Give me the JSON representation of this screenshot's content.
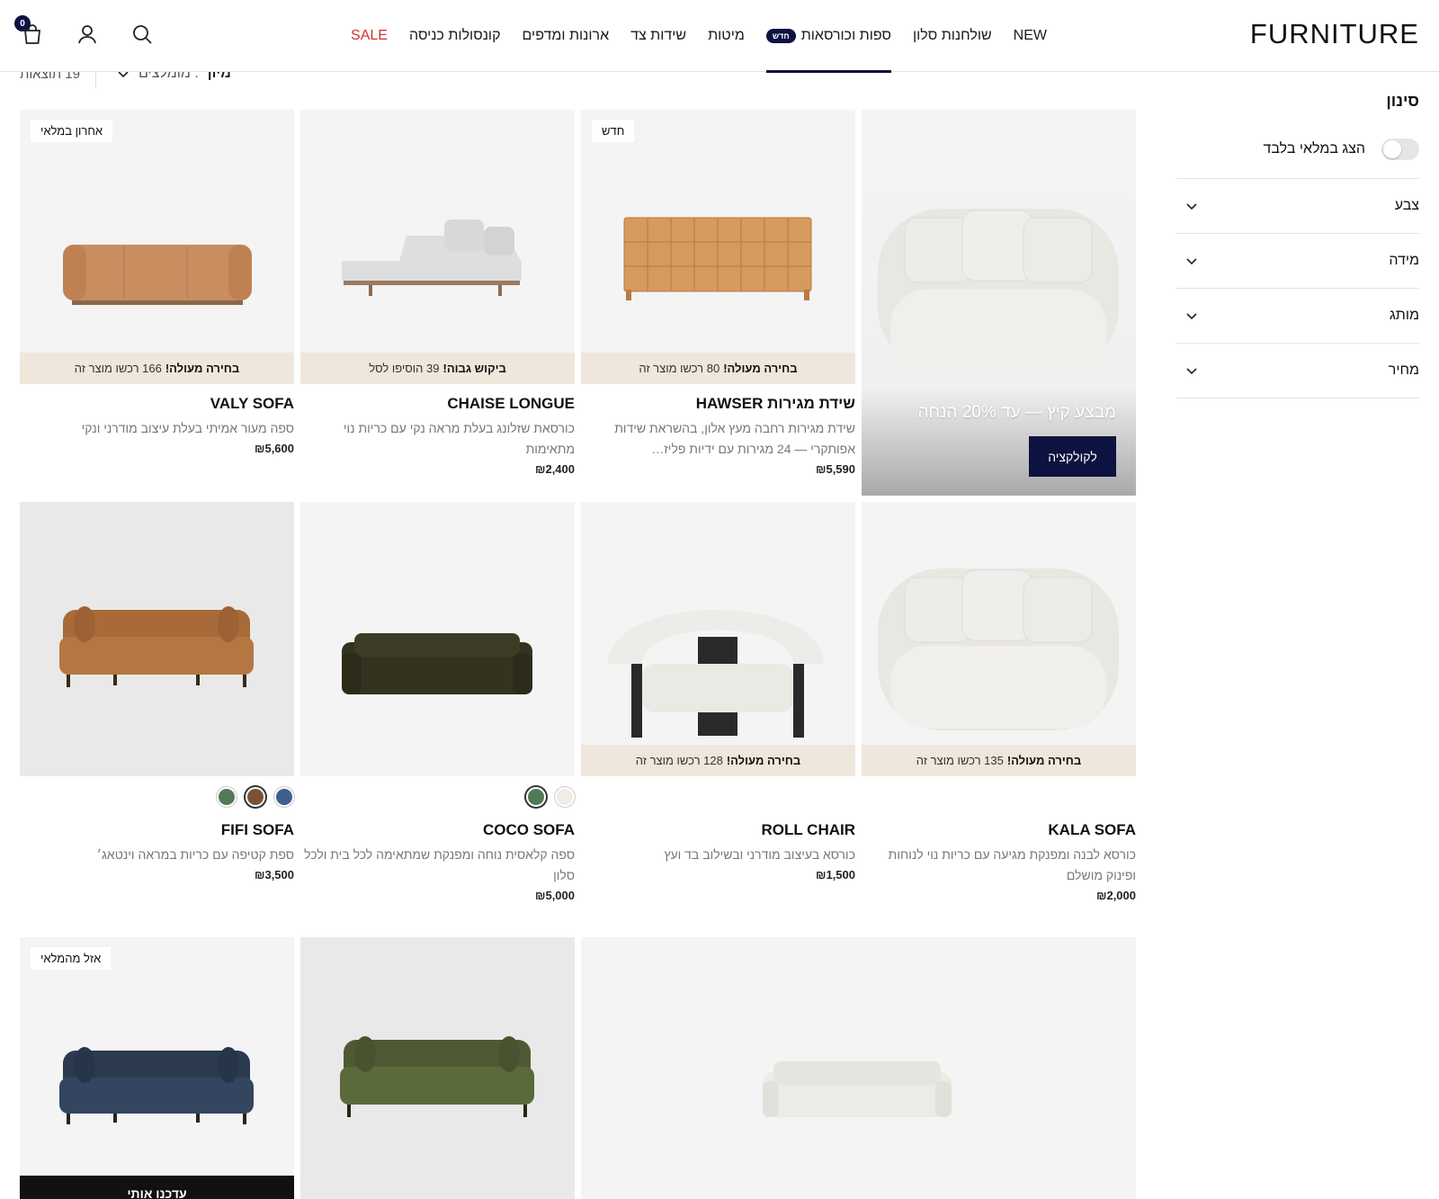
{
  "header": {
    "logo": "FURNITURE",
    "nav": [
      {
        "label": "NEW"
      },
      {
        "label": "שולחנות סלון"
      },
      {
        "label": "ספות וכורסאות",
        "badge": "חדש",
        "active": true
      },
      {
        "label": "מיטות"
      },
      {
        "label": "שידות צד"
      },
      {
        "label": "ארונות ומדפים"
      },
      {
        "label": "קונסולות כניסה"
      },
      {
        "label": "SALE"
      }
    ],
    "cart_count": "0"
  },
  "toolbar": {
    "results": "19 תוצאות",
    "sort_label": "מיון",
    "sort_value": ": מומלצים"
  },
  "filters": {
    "title": "סינון",
    "in_stock_label": "הצג במלאי בלבד",
    "in_stock_on": false,
    "facets": [
      "צבע",
      "מידה",
      "מותג",
      "מחיר"
    ]
  },
  "promo": {
    "text": "מבצע קיץ — עד 20% הנחה",
    "button": "לקולקציה"
  },
  "products": [
    {
      "name": "שידת מגירות HAWSER",
      "desc": "שידת מגירות רחבה מעץ אלון, בהשראת שידות אפותקרי — 24 מגירות עם ידיות פליז…",
      "price": "₪5,590",
      "tag": "חדש",
      "strip_bold": "בחירה מעולה!",
      "strip_text": "80 רכשו מוצר זה"
    },
    {
      "name": "CHAISE LONGUE",
      "desc": "כורסאת שזלונג בעלת מראה נקי עם כריות נוי מתאימות",
      "price": "₪2,400",
      "strip_bold": "ביקוש גבוה!",
      "strip_text": "39 הוסיפו לסל"
    },
    {
      "name": "VALY SOFA",
      "desc": "ספה מעור אמיתי בעלת עיצוב מודרני ונקי",
      "price": "₪5,600",
      "tag": "אחרון במלאי",
      "strip_bold": "בחירה מעולה!",
      "strip_text": "166 רכשו מוצר זה"
    },
    {
      "name": "KALA SOFA",
      "desc": "כורסא לבנה ומפנקת מגיעה עם כריות נוי לנוחות ופינוק מושלם",
      "price": "₪2,000",
      "strip_bold": "בחירה מעולה!",
      "strip_text": "135 רכשו מוצר זה"
    },
    {
      "name": "ROLL CHAIR",
      "desc": "כורסא בעיצוב מודרני ובשילוב בד ועץ",
      "price": "₪1,500",
      "strip_bold": "בחירה מעולה!",
      "strip_text": "128 רכשו מוצר זה"
    },
    {
      "name": "COCO SOFA",
      "desc": "ספה קלאסית נוחה ומפנקת שמתאימה לכל בית ולכל סלון",
      "price": "₪5,000",
      "swatches": [
        "#4f7a56",
        "#f1ede6"
      ],
      "selected_swatch": 0
    },
    {
      "name": "FIFI SOFA",
      "desc": "ספת קטיפה עם כריות במראה וינטאג׳",
      "price": "₪3,500",
      "swatches": [
        "#3f5f8f",
        "#7a5233",
        "#527a55"
      ],
      "selected_swatch": 1
    },
    {
      "tag": "אזל מהמלאי",
      "notify": "עדכנו אותי"
    }
  ]
}
